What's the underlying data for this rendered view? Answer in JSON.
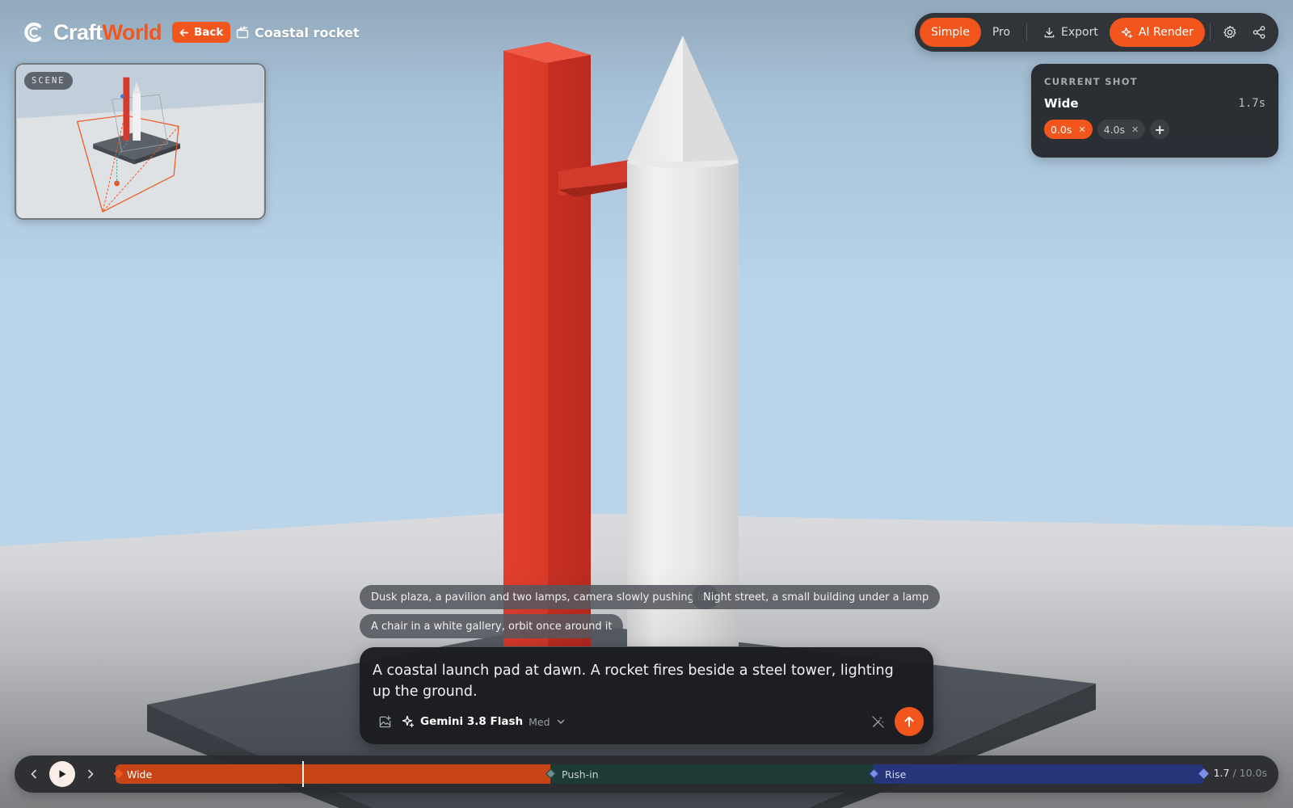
{
  "brand": {
    "name_part1": "Craft",
    "name_part2": "World",
    "icon": "craftworld-logo-icon"
  },
  "header": {
    "back_label": "Back",
    "back_icon": "arrow-left-icon",
    "project_title": "Coastal rocket",
    "project_icon": "clapperboard-icon"
  },
  "toolbar": {
    "mode_simple": "Simple",
    "mode_pro": "Pro",
    "active_mode": "Simple",
    "export_label": "Export",
    "ai_render_label": "AI Render",
    "icons": [
      "download-icon",
      "sparkle-icon",
      "gear-icon",
      "share-icon"
    ]
  },
  "minimap": {
    "label": "SCENE"
  },
  "current_shot": {
    "heading": "CURRENT SHOT",
    "name": "Wide",
    "duration": "1.7s",
    "keyframes": [
      {
        "time": "0.0s",
        "active": true
      },
      {
        "time": "4.0s",
        "active": false
      }
    ],
    "add_label": "+"
  },
  "suggestions": [
    "Dusk plaza, a pavilion and two lamps, camera slowly pushing in",
    "Night street, a small building under a lamp",
    "A chair in a white gallery, orbit once around it"
  ],
  "prompt": {
    "text": "A coastal launch pad at dawn. A rocket fires beside a steel tower, lighting up the ground.",
    "model_name": "Gemini 3.8 Flash",
    "model_level": "Med"
  },
  "timeline": {
    "segments": [
      {
        "label": "Wide",
        "color": "#c74417"
      },
      {
        "label": "Push-in",
        "color": "#1e3a36"
      },
      {
        "label": "Rise",
        "color": "#26347a"
      }
    ],
    "current_time": "1.7",
    "total_time": "/ 10.0s"
  },
  "colors": {
    "accent": "#f2561d",
    "panel": "#282a2e",
    "sky": "#b8cfe0"
  }
}
